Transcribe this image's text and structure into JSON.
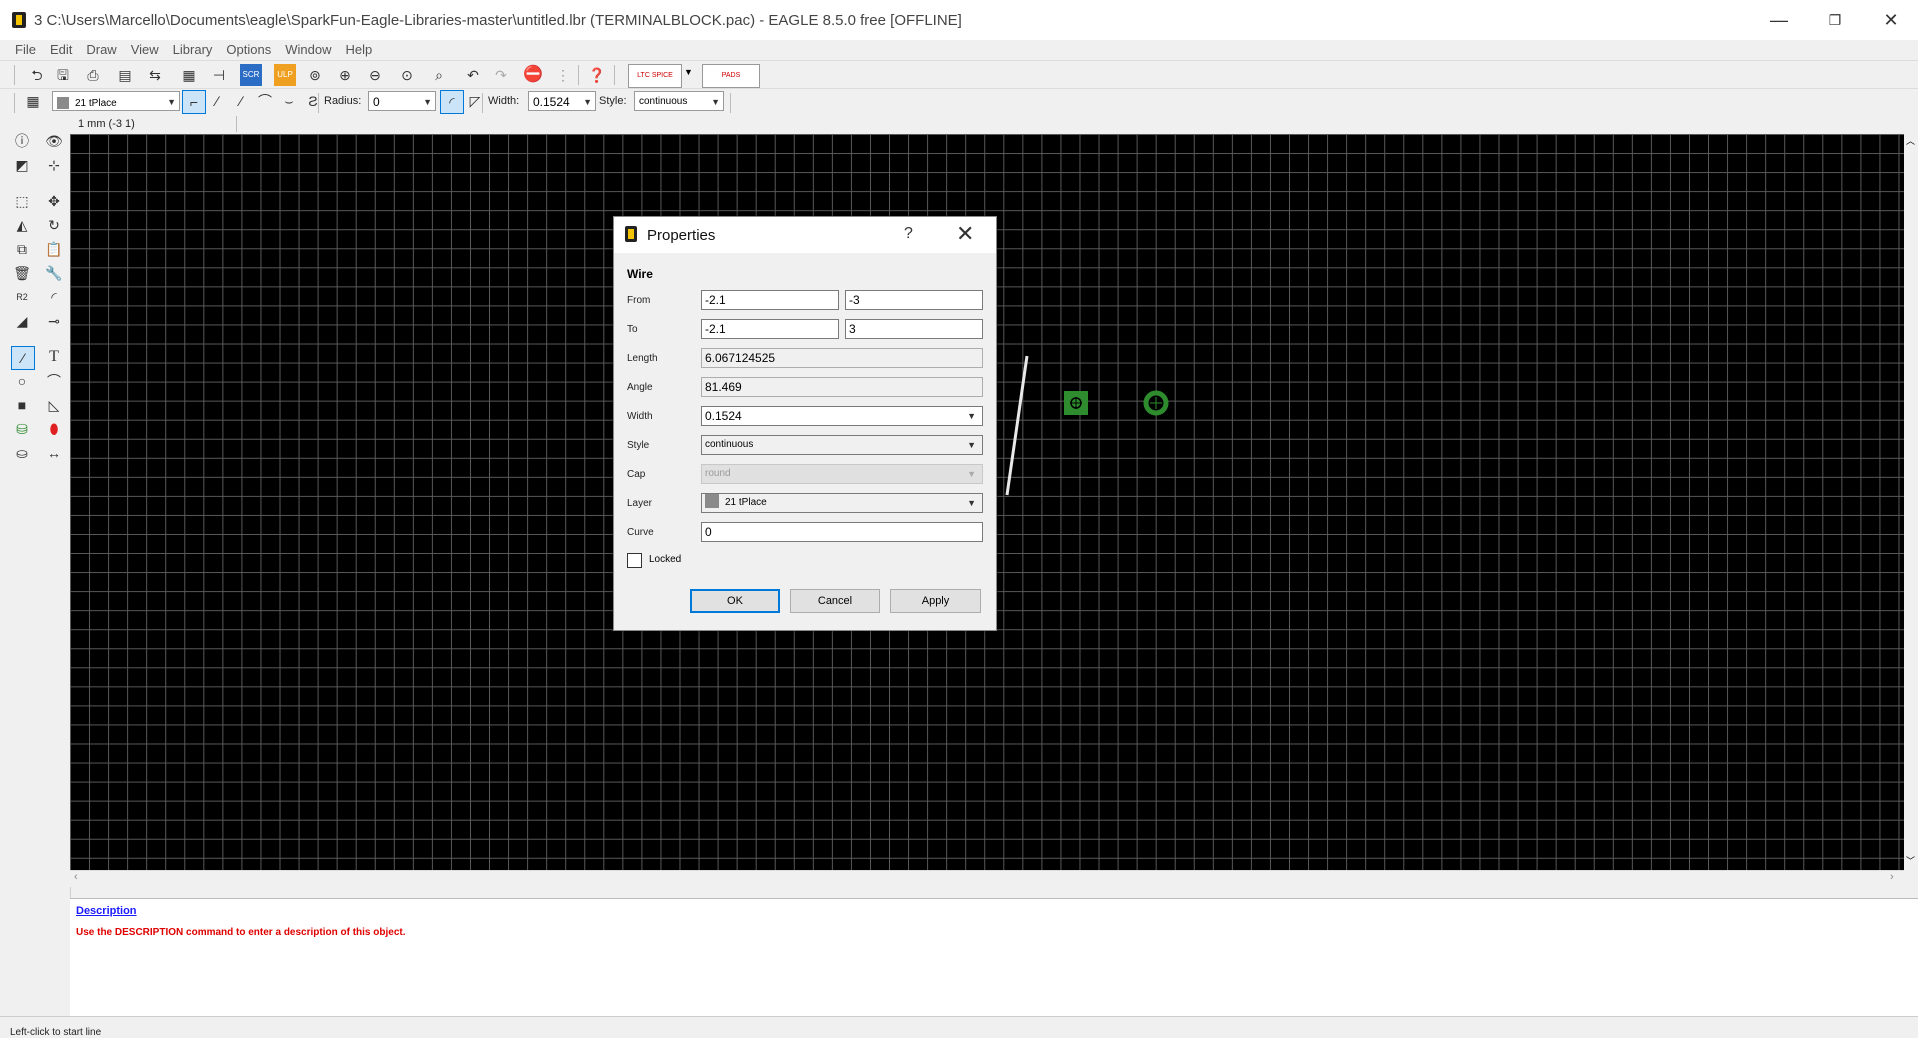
{
  "window": {
    "title": "3 C:\\Users\\Marcello\\Documents\\eagle\\SparkFun-Eagle-Libraries-master\\untitled.lbr (TERMINALBLOCK.pac) - EAGLE 8.5.0 free [OFFLINE]",
    "controls": [
      "—",
      "❐",
      "✕"
    ]
  },
  "menu": [
    "File",
    "Edit",
    "Draw",
    "View",
    "Library",
    "Options",
    "Window",
    "Help"
  ],
  "toolbar1": {
    "ltspice_label": "LTC SPICE",
    "pads_label": "PADS"
  },
  "toolbar2": {
    "layer": "21 tPlace",
    "radius_label": "Radius:",
    "radius_value": "0",
    "width_label": "Width:",
    "width_value": "0.1524",
    "style_label": "Style:",
    "style_value": "continuous"
  },
  "coord_readout": "1 mm (-3 1)",
  "dialog": {
    "title": "Properties",
    "help": "?",
    "close": "✕",
    "section": "Wire",
    "from_label": "From",
    "from_x": "-2.1",
    "from_y": "-3",
    "to_label": "To",
    "to_x": "-2.1",
    "to_y": "3",
    "length_label": "Length",
    "length_value": "6.067124525",
    "angle_label": "Angle",
    "angle_value": "81.469",
    "width_label": "Width",
    "width_value": "0.1524",
    "style_label": "Style",
    "style_value": "continuous",
    "cap_label": "Cap",
    "cap_value": "round",
    "layer_label": "Layer",
    "layer_value": "21 tPlace",
    "curve_label": "Curve",
    "curve_value": "0",
    "locked_label": "Locked",
    "ok": "OK",
    "cancel": "Cancel",
    "apply": "Apply"
  },
  "description": {
    "link": "Description",
    "text": "Use the DESCRIPTION command to enter a description of this object."
  },
  "status": "Left-click to start line",
  "colors": {
    "canvas": "#000000",
    "grid": "#5a5a5a",
    "pad_green": "#2e8b2e",
    "description_text": "#e00000",
    "link": "#1a1aff"
  }
}
